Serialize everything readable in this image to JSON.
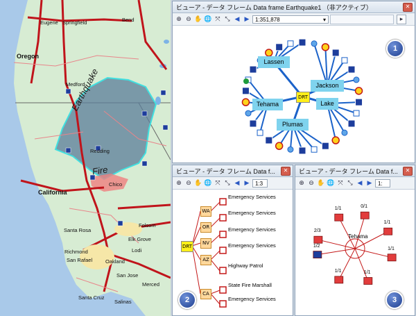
{
  "map": {
    "cities": [
      "Eugene",
      "Springfield",
      "Bend",
      "Oregon",
      "Medford",
      "Redding",
      "Chico",
      "California",
      "Santa Rosa",
      "Folsom",
      "Elk Grove",
      "Lodi",
      "Richmond",
      "San Rafael",
      "Oakland",
      "San Jose",
      "Merced",
      "Santa Cruz",
      "Salinas"
    ],
    "labels": {
      "earthquake": "Earthquake",
      "fire": "Fire"
    }
  },
  "window1": {
    "title": "ビューア - データ フレーム Data frame Earthquake1 （非アクティブ）",
    "scale": "1:351,878",
    "center": "DRT",
    "nodes": [
      "Lassen",
      "Jackson",
      "Tehama",
      "Lake",
      "Plumas"
    ],
    "badge": "1"
  },
  "window2": {
    "title": "ビューア - データ フレーム Data f...",
    "scale": "1:3",
    "root": "DRT",
    "states": [
      "WA",
      "OR",
      "NV",
      "AZ",
      "CA"
    ],
    "services": [
      "Emergency Services",
      "Emergency Services",
      "Emergency Services",
      "Emergency Services",
      "Highway Patrol",
      "State Fire Marshall",
      "Emergency Services"
    ],
    "badge": "2"
  },
  "window3": {
    "title": "ビューア - データ フレーム Data f...",
    "scale": "1:",
    "center": "Tehama",
    "ratios": [
      "1/1",
      "0/1",
      "1/1",
      "2/3",
      "1/1",
      "1/2",
      "1/1",
      "1/1"
    ],
    "badge": "3"
  }
}
